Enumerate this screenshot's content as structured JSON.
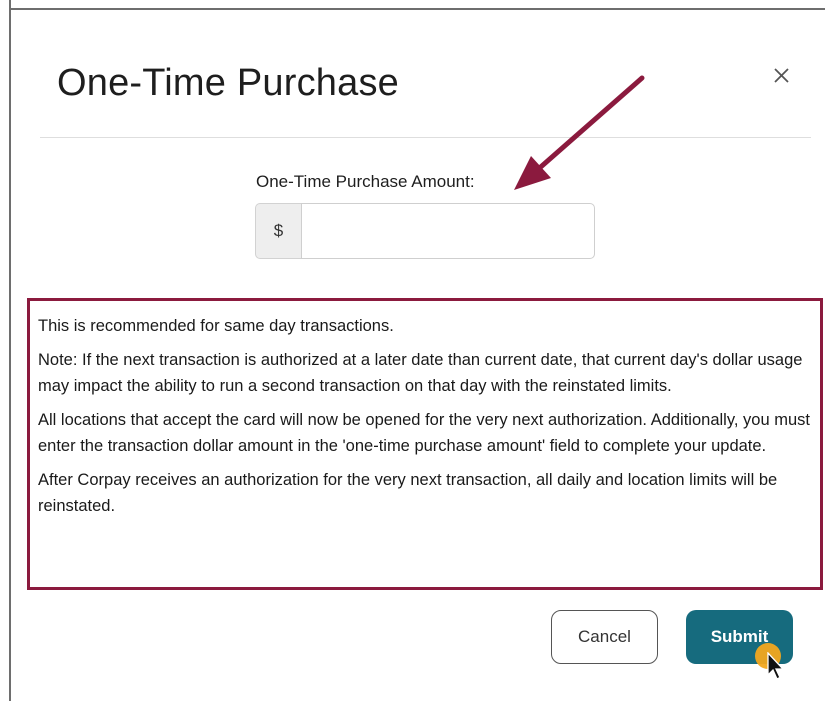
{
  "dialog": {
    "title": "One-Time Purchase",
    "close_label": "X"
  },
  "form": {
    "amount_label": "One-Time Purchase Amount:",
    "currency_symbol": "$",
    "amount_value": "",
    "amount_placeholder": ""
  },
  "notice": {
    "paragraphs": [
      "This is recommended for same day transactions.",
      "Note: If the next transaction is authorized at a later date than current date, that current day's dollar usage may impact the ability to run a second transaction on that day with the reinstated limits.",
      "All locations that accept the card will now be opened for the very next authorization. Additionally, you must enter the transaction dollar amount in the 'one-time purchase amount' field to complete your update.",
      "After Corpay receives an authorization for the very next transaction, all daily and location limits will be reinstated."
    ]
  },
  "actions": {
    "cancel_label": "Cancel",
    "submit_label": "Submit"
  },
  "colors": {
    "highlight_border": "#8b1a3e",
    "annotation_arrow": "#8b1a3e",
    "submit_background": "#166b7e",
    "click_indicator": "#f2a81f"
  },
  "icons": {
    "close": "close-icon",
    "annotation": "arrow-annotation-icon",
    "pointer": "cursor-pointer-icon"
  }
}
